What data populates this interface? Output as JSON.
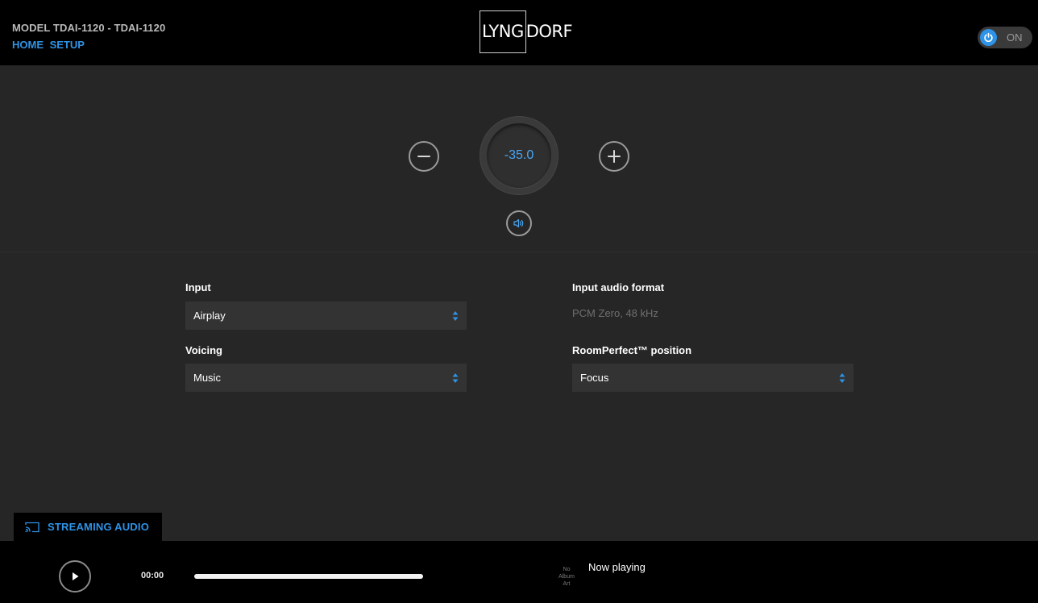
{
  "header": {
    "model": "MODEL TDAI-1120 - TDAI-1120",
    "nav": {
      "home": "HOME",
      "setup": "SETUP"
    },
    "logo": {
      "boxed": "LYNG",
      "rest": "DORF"
    },
    "power_label": "ON"
  },
  "volume": {
    "value": "-35.0",
    "icons": [
      "minus-icon",
      "plus-icon",
      "speaker-icon"
    ]
  },
  "settings": {
    "input": {
      "label": "Input",
      "value": "Airplay"
    },
    "input_audio_format": {
      "label": "Input audio format",
      "value": "PCM Zero, 48 kHz"
    },
    "voicing": {
      "label": "Voicing",
      "value": "Music"
    },
    "roomperfect": {
      "label": "RoomPerfect™ position",
      "value": "Focus"
    }
  },
  "streaming_tab": {
    "label": "STREAMING AUDIO",
    "icon": "cast-icon"
  },
  "player": {
    "time": "00:00",
    "progress": 1.0,
    "album_art": [
      "No",
      "Album",
      "Art"
    ],
    "now_playing": "Now playing"
  },
  "colors": {
    "accent": "#2e93e6",
    "background": "#262626",
    "header": "#000000",
    "select_bg": "#333333"
  }
}
